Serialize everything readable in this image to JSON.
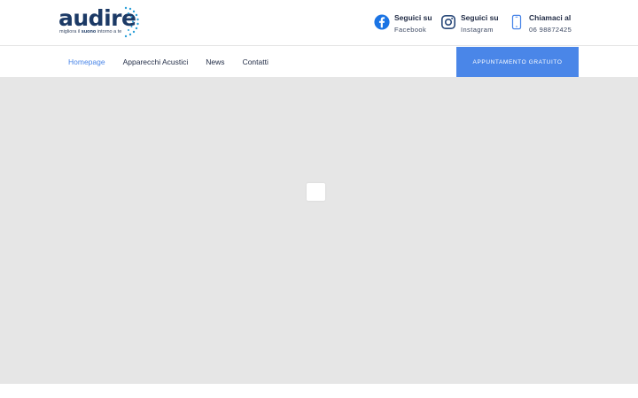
{
  "header": {
    "logo": {
      "word": "audire",
      "tagline_pre": "migliora il ",
      "tagline_bold": "suono",
      "tagline_post": " intorno a te"
    },
    "contacts": [
      {
        "icon": "facebook-icon",
        "title": "Seguici su",
        "value": "Facebook"
      },
      {
        "icon": "instagram-icon",
        "title": "Seguici su",
        "value": "Instagram"
      },
      {
        "icon": "phone-icon",
        "title": "Chiamaci al",
        "value": "06 98872425"
      }
    ]
  },
  "nav": {
    "items": [
      "Homepage",
      "Apparecchi Acustici",
      "News",
      "Contatti"
    ],
    "active": "Homepage",
    "cta": "APPUNTAMENTO GRATUITO"
  },
  "colors": {
    "accent": "#4a86e8",
    "brand_dark": "#1c3a66",
    "hero_bg": "#e6e6e6"
  }
}
